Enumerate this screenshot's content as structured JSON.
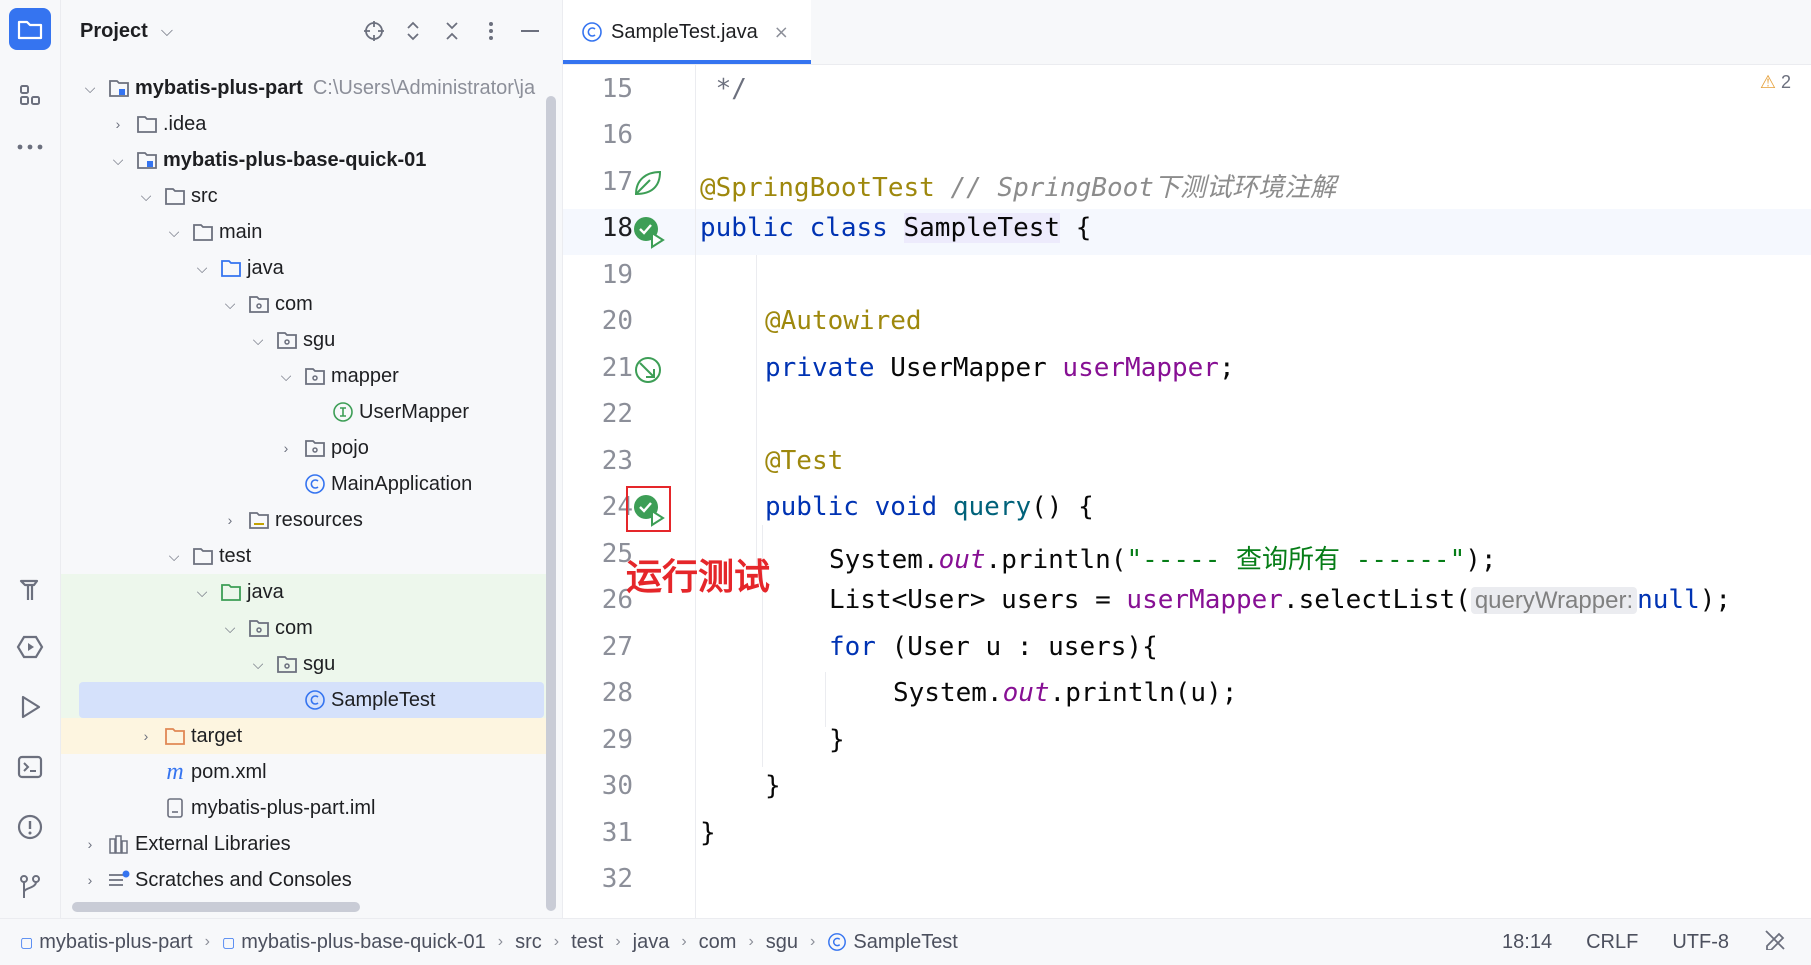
{
  "panel": {
    "title": "Project"
  },
  "tab": {
    "label": "SampleTest.java",
    "close": "×"
  },
  "tree": [
    {
      "label": "mybatis-plus-part",
      "hint": "C:\\Users\\Administrator\\ja"
    },
    {
      "label": ".idea"
    },
    {
      "label": "mybatis-plus-base-quick-01"
    },
    {
      "label": "src"
    },
    {
      "label": "main"
    },
    {
      "label": "java"
    },
    {
      "label": "com"
    },
    {
      "label": "sgu"
    },
    {
      "label": "mapper"
    },
    {
      "label": "UserMapper"
    },
    {
      "label": "pojo"
    },
    {
      "label": "MainApplication"
    },
    {
      "label": "resources"
    },
    {
      "label": "test"
    },
    {
      "label": "java"
    },
    {
      "label": "com"
    },
    {
      "label": "sgu"
    },
    {
      "label": "SampleTest"
    },
    {
      "label": "target"
    },
    {
      "label": "pom.xml"
    },
    {
      "label": "mybatis-plus-part.iml"
    },
    {
      "label": "External Libraries"
    },
    {
      "label": "Scratches and Consoles"
    }
  ],
  "editor": {
    "line_numbers": [
      "15",
      "16",
      "17",
      "18",
      "19",
      "20",
      "21",
      "22",
      "23",
      "24",
      "25",
      "26",
      "27",
      "28",
      "29",
      "30",
      "31",
      "32"
    ],
    "warnings": "2",
    "annotation": "运行测试",
    "code": {
      "l15": " */",
      "l17_ann": "@SpringBootTest",
      "l17_cmt": " // SpringBoot下测试环境注解",
      "l18_kw": "public class ",
      "l18_cls": "SampleTest",
      "l18_rest": " {",
      "l20": "@Autowired",
      "l21_kw": "private ",
      "l21_type": "UserMapper ",
      "l21_fld": "userMapper",
      "l21_end": ";",
      "l23": "@Test",
      "l24_kw": "public void ",
      "l24_m": "query",
      "l24_rest": "() {",
      "l25_a": "System.",
      "l25_out": "out",
      "l25_b": ".println(",
      "l25_str": "\"----- 查询所有 ------\"",
      "l25_c": ");",
      "l26_a": "List<User> users = ",
      "l26_fld": "userMapper",
      "l26_b": ".selectList(",
      "l26_hint": "queryWrapper:",
      "l26_null": "null",
      "l26_c": ");",
      "l27_kw": "for",
      "l27_rest": " (User u : users){",
      "l28_a": "System.",
      "l28_out": "out",
      "l28_b": ".println(u);",
      "l29": "}",
      "l30": "}",
      "l31": "}"
    }
  },
  "status": {
    "crumbs": [
      "mybatis-plus-part",
      "mybatis-plus-base-quick-01",
      "src",
      "test",
      "java",
      "com",
      "sgu",
      "SampleTest"
    ],
    "position": "18:14",
    "line_sep": "CRLF",
    "encoding": "UTF-8"
  },
  "colors": {
    "accent": "#3574f0",
    "annotation_red": "#e5262a",
    "run_green": "#3d9e56"
  },
  "icons": [
    "folder-icon",
    "structure-icon",
    "more-icon",
    "build-icon",
    "services-icon",
    "run-icon",
    "terminal-icon",
    "problems-icon",
    "git-icon"
  ]
}
